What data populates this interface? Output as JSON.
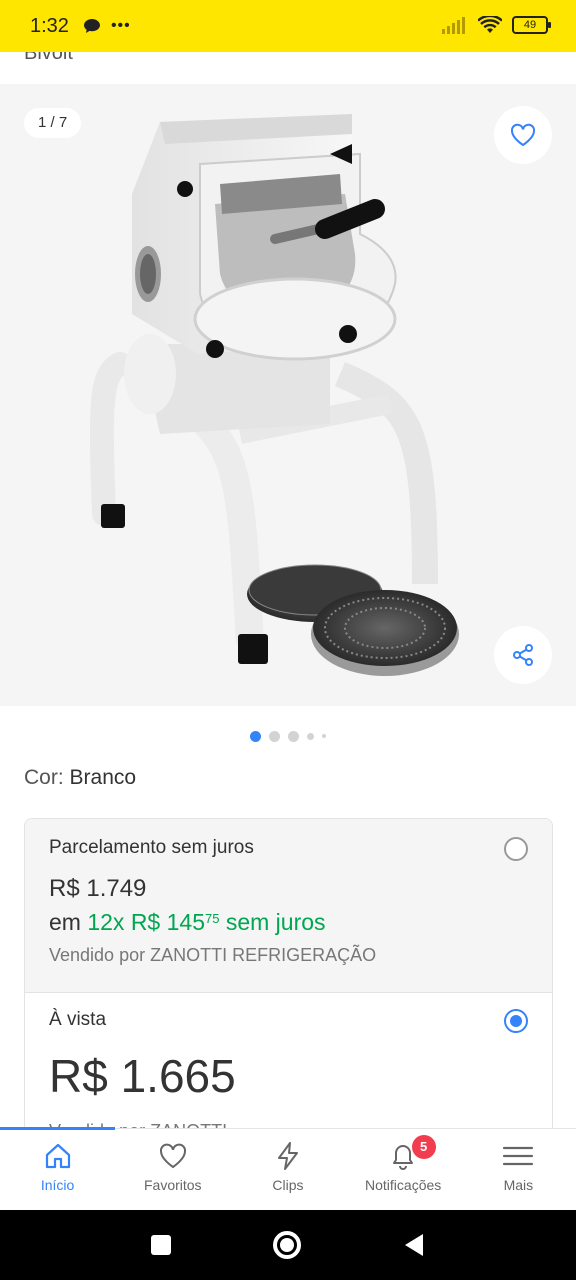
{
  "status": {
    "time": "1:32",
    "battery": "49"
  },
  "header": {
    "cut_title": "Bivolt"
  },
  "gallery": {
    "counter": "1 / 7"
  },
  "product": {
    "color_label": "Cor: ",
    "color_value": "Branco"
  },
  "options": {
    "installment": {
      "title": "Parcelamento sem juros",
      "price": "R$ 1.749",
      "prefix": "em ",
      "green_text": "12x R$ 145",
      "cents": "75",
      "suffix": " sem juros",
      "seller": "Vendido por ZANOTTI REFRIGERAÇÃO"
    },
    "cash": {
      "title": "À vista",
      "price": "R$ 1.665",
      "cut_text": "Vendido por ZANOTTI"
    }
  },
  "nav": {
    "items": [
      {
        "label": "Início"
      },
      {
        "label": "Favoritos"
      },
      {
        "label": "Clips"
      },
      {
        "label": "Notificações",
        "badge": "5"
      },
      {
        "label": "Mais"
      }
    ]
  },
  "colors": {
    "accent": "#3483fa",
    "green": "#00a650",
    "badge": "#f23d4f",
    "statusbar": "#ffe600"
  }
}
